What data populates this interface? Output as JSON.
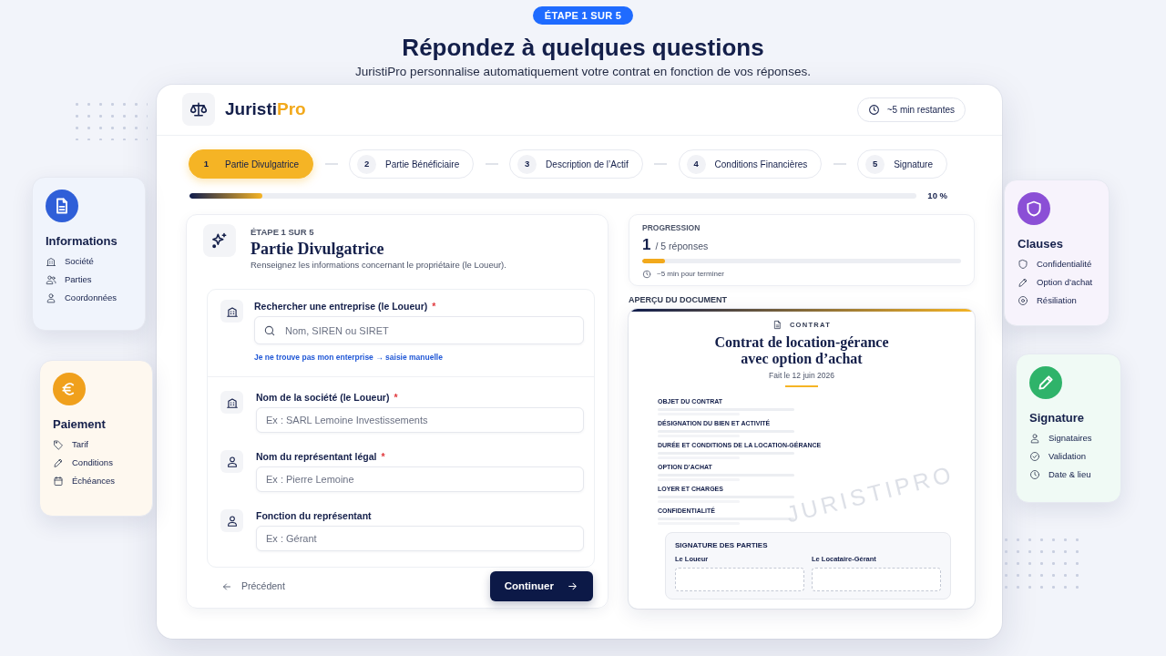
{
  "header": {
    "badge": "ÉTAPE 1 SUR 5",
    "title": "Répondez à quelques questions",
    "subtitle": "JuristiPro personnalise automatiquement votre contrat en fonction de vos réponses."
  },
  "feature_cards": [
    {
      "title": "Informations",
      "color": "#2f5fd8",
      "items": [
        "Société",
        "Parties",
        "Coordonnées"
      ]
    },
    {
      "title": "Paiement",
      "color": "#f0a01c",
      "items": [
        "Tarif",
        "Conditions",
        "Échéances"
      ]
    },
    {
      "title": "Clauses",
      "color": "#8b4fd6",
      "items": [
        "Confidentialité",
        "Option d’achat",
        "Résiliation"
      ]
    },
    {
      "title": "Signature",
      "color": "#2fb36a",
      "items": [
        "Signataires",
        "Validation",
        "Date & lieu"
      ]
    }
  ],
  "app": {
    "brand": {
      "text": "Juristi",
      "accent": "Pro"
    },
    "time_left": "~5 min restantes",
    "steps": [
      {
        "number": "1",
        "label": "Partie Divulgatrice",
        "selected": true
      },
      {
        "number": "2",
        "label": "Partie Bénéficiaire",
        "selected": false
      },
      {
        "number": "3",
        "label": "Description de l’Actif",
        "selected": false
      },
      {
        "number": "4",
        "label": "Conditions Financières",
        "selected": false
      },
      {
        "number": "5",
        "label": "Signature",
        "selected": false
      }
    ],
    "progress": {
      "level": 0.1,
      "reading": "10 %"
    }
  },
  "form": {
    "step_label": "ÉTAPE 1 SUR 5",
    "title": "Partie Divulgatrice",
    "description": "Renseignez les informations concernant le propriétaire (le Loueur).",
    "search": {
      "label": "Rechercher une entreprise (le Loueur)",
      "required_mark": "*",
      "placeholder": "Nom, SIREN ou SIRET",
      "link": "Je ne trouve pas mon enterprise → saisie manuelle"
    },
    "fields": [
      {
        "kind": "company",
        "label": "Nom de la société (le Loueur)",
        "required_mark": "*",
        "placeholder": "Ex : SARL Lemoine Investissements"
      },
      {
        "kind": "person",
        "label": "Nom du représentant légal",
        "required_mark": "*",
        "placeholder": "Ex : Pierre Lemoine"
      },
      {
        "kind": "person",
        "label": "Fonction du représentant",
        "placeholder": "Ex : Gérant"
      }
    ],
    "back_button": "Précédent",
    "next_button": "Continuer"
  },
  "summary": {
    "title": "PROGRESSION",
    "count": "1",
    "total": "/ 5 réponses",
    "level": 0.07,
    "time": "~5 min pour terminer"
  },
  "preview": {
    "label": "APERÇU DU DOCUMENT",
    "doc_type": "CONTRAT",
    "title": "Contrat de location-gérance avec option d’achat",
    "date": "Fait le 12 juin 2026",
    "watermark": "JURISTIPRO",
    "sections": [
      "OBJET DU CONTRAT",
      "DÉSIGNATION DU BIEN ET ACTIVITÉ",
      "DURÉE ET CONDITIONS DE LA LOCATION-GÉRANCE",
      "OPTION D’ACHAT",
      "LOYER ET CHARGES",
      "CONFIDENTIALITÉ"
    ],
    "signature": {
      "title": "SIGNATURE DES PARTIES",
      "parties": [
        "Le Loueur",
        "Le Locataire-Gérant"
      ]
    }
  }
}
